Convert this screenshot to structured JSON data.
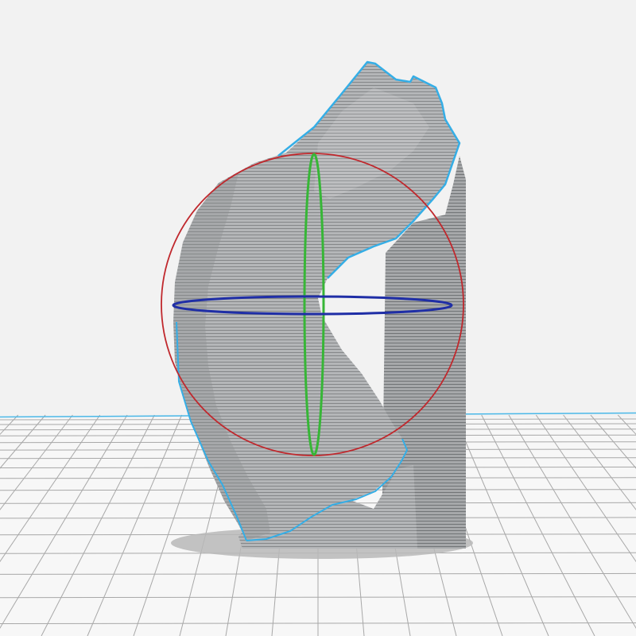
{
  "viewport": {
    "background_color": "#f2f2f2",
    "build_plate": {
      "fill_color": "#f7f7f7",
      "grid_color": "#a8a8a8",
      "edge_color": "#4ab8e8"
    },
    "model": {
      "surface_color": "#b4b6b8",
      "layer_line_color": "#5e6163",
      "outline_color": "#35aee6",
      "shadow_color": "#b8b8b8"
    },
    "rotate_gizmo": {
      "x_ring_color": "#c0282d",
      "y_ring_color": "#37b637",
      "z_ring_color": "#1f2ea6"
    }
  }
}
